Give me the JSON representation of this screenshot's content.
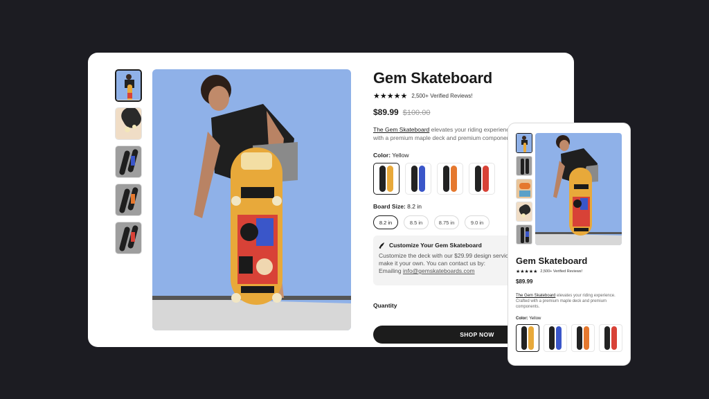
{
  "product": {
    "title": "Gem Skateboard",
    "stars": "★★★★★",
    "reviews": "2,500+ Verified Reviews!",
    "price": "$89.99",
    "old_price": "$100.00",
    "desc_brand": "The Gem Skateboard",
    "desc_line1": " elevates your riding experience. Crafted",
    "desc_line2": "with a premium maple deck and premium components."
  },
  "color": {
    "label": "Color:",
    "value": "Yellow",
    "swatches": [
      {
        "name": "Yellow",
        "color": "#e8a93a"
      },
      {
        "name": "Blue",
        "color": "#3a56c9"
      },
      {
        "name": "Orange",
        "color": "#e5782e"
      },
      {
        "name": "Red",
        "color": "#d84237"
      }
    ]
  },
  "board_size": {
    "label": "Board Size:",
    "value": "8.2 in",
    "options": [
      "8.2 in",
      "8.5 in",
      "8.75 in",
      "9.0 in"
    ]
  },
  "customize": {
    "title": "Customize Your Gem Skateboard",
    "line1": "Customize the deck with our $29.99 design service to",
    "line2": "make it your own. You can contact us by:",
    "line3_prefix": "Emailing ",
    "email": "info@gemskateboards.com"
  },
  "quantity": {
    "label": "Quantity",
    "minus": "−"
  },
  "cta": {
    "label": "SHOP NOW"
  },
  "mobile": {
    "title": "Gem Skateboard",
    "stars": "★★★★★",
    "reviews": "2,500+ Verified Reviews!",
    "price": "$89.99",
    "desc_brand": "The Gem Skateboard",
    "desc_rest": " elevates your riding experience. Crafted with a premium maple deck and premium components.",
    "color_label": "Color:",
    "color_value": "Yellow"
  },
  "colors": {
    "sky": "#8fb1e8",
    "deck": "#e8a93a",
    "dark": "#1c1c22"
  }
}
